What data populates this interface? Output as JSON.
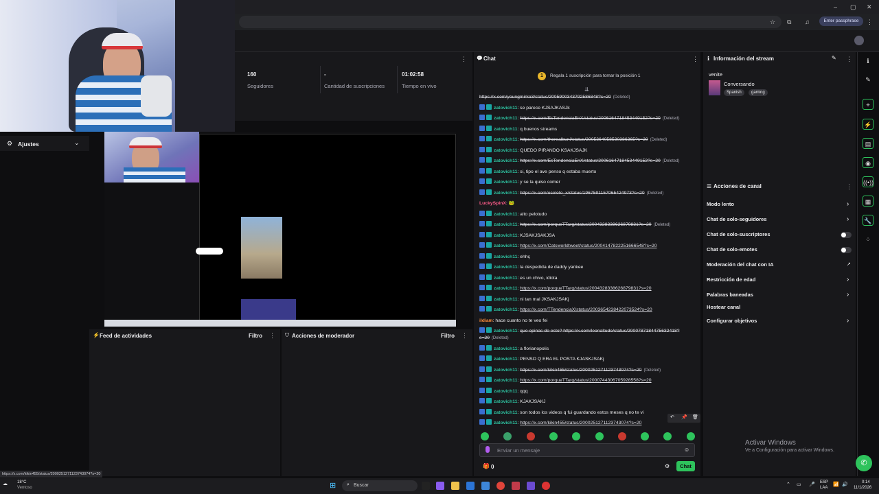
{
  "browser": {
    "passphrase_label": "Enter passphrase"
  },
  "stats": [
    {
      "value": "160",
      "label": "Seguidores"
    },
    {
      "value": "-",
      "label": "Cantidad de suscripciones"
    },
    {
      "value": "01:02:58",
      "label": "Tiempo en vivo"
    }
  ],
  "ajustes": {
    "label": "Ajustes"
  },
  "feed": {
    "title": "Feed de actividades",
    "filter": "Filtro"
  },
  "mod": {
    "title": "Acciones de moderador",
    "filter": "Filtro"
  },
  "chat": {
    "title": "Chat",
    "gift_banner": "Regala 1 suscripción para tomar la posición 1",
    "gift_rank": "1",
    "messages": [
      {
        "user": "",
        "text": "https://x.com/youngmirko3/status/2005900343792586848?s=20",
        "deleted": "(Deleted)"
      },
      {
        "user": "zatovich11",
        "text": "se parece KJSAJKASJk",
        "deleted": ""
      },
      {
        "user": "zatovich11",
        "text": "https://x.com/EsTendenciaEnX/status/2006164718453449152?s=20",
        "deleted": "(Deleted)"
      },
      {
        "user": "zatovich11",
        "text": "q buenos streams",
        "deleted": ""
      },
      {
        "user": "zatovich11",
        "text": "https://x.com/therealbuni/status/2005364058530386365?s=20",
        "deleted": "(Deleted)"
      },
      {
        "user": "zatovich11",
        "text": "QUEDO PIRANDO KSAKJSAJK",
        "deleted": ""
      },
      {
        "user": "zatovich11",
        "text": "https://x.com/EsTendenciaEnX/status/2006164718453449152?s=20",
        "deleted": "(Deleted)"
      },
      {
        "user": "zatovich11",
        "text": "si, tipo el ave penso q estaba muerto",
        "deleted": ""
      },
      {
        "user": "zatovich11",
        "text": "y se la quiso comer",
        "deleted": ""
      },
      {
        "user": "zatovich11",
        "text": "https://x.com/ocelote_x/status/1967591157065424973?s=20",
        "deleted": "(Deleted)"
      },
      {
        "user": "LuckySpinX",
        "text": "🐸",
        "deleted": ""
      },
      {
        "user": "zatovich11",
        "text": "alto pelotudo",
        "deleted": ""
      },
      {
        "user": "zatovich11",
        "text": "https://x.com/porqueTTarg/status/2004328338626879831?s=20",
        "deleted": "(Deleted)"
      },
      {
        "user": "zatovich11",
        "text": "KJSAKJSAKJSA",
        "deleted": ""
      },
      {
        "user": "zatovich11",
        "text": "https://x.com/Catsworldtweet/status/2004147822251666548?s=20",
        "deleted": ""
      },
      {
        "user": "zatovich11",
        "text": "ehhç",
        "deleted": ""
      },
      {
        "user": "zatovich11",
        "text": "la despedida de daddy yankee",
        "deleted": ""
      },
      {
        "user": "zatovich11",
        "text": "es un chivo, idiota",
        "deleted": ""
      },
      {
        "user": "zatovich11",
        "text": "https://x.com/porqueTTarg/status/2004328338626879831?s=20",
        "deleted": ""
      },
      {
        "user": "zatovich11",
        "text": "ni tan mal JKSAKJSAKj",
        "deleted": ""
      },
      {
        "user": "zatovich11",
        "text": "https://x.com/TTendenciaX/status/2003654238422073524?s=20",
        "deleted": ""
      },
      {
        "user": "ildiam",
        "text": "hace cuanto no te veo fei",
        "deleted": ""
      },
      {
        "user": "zatovich11",
        "text": "que opinas de esto? https://x.com/leonaltudo/status/2000787184475632418?s=20",
        "deleted": "(Deleted)"
      },
      {
        "user": "zatovich11",
        "text": "a florianopolis",
        "deleted": ""
      },
      {
        "user": "zatovich11",
        "text": "PENSO Q ERA EL POSTA KJASKJSAKj",
        "deleted": ""
      },
      {
        "user": "zatovich11",
        "text": "https://x.com/kikin455/status/2000251271123743074?s=20",
        "deleted": "(Deleted)"
      },
      {
        "user": "zatovich11",
        "text": "https://x.com/porqueTTarg/status/2000744306705928558?s=20",
        "deleted": ""
      },
      {
        "user": "zatovich11",
        "text": "qqq",
        "deleted": ""
      },
      {
        "user": "zatovich11",
        "text": "KJAKJSAKJ",
        "deleted": ""
      },
      {
        "user": "zatovich11",
        "text": "son todos los videos q fui guardando estos meses q no te vi",
        "deleted": ""
      },
      {
        "user": "zatovich11",
        "text": "https://x.com/kikin455/status/2000251271123743074?s=20",
        "deleted": ""
      }
    ],
    "input_placeholder": "Enviar un mensaje",
    "points": "0",
    "send_label": "Chat"
  },
  "info": {
    "title": "Información del stream",
    "channel": "venite",
    "category": "Conversando",
    "tags": [
      "Spanish",
      "gaming"
    ]
  },
  "acciones": {
    "title": "Acciones de canal",
    "items": [
      {
        "label": "Modo lento",
        "control": "chevron"
      },
      {
        "label": "Chat de solo-seguidores",
        "control": "chevron"
      },
      {
        "label": "Chat de solo-suscriptores",
        "control": "toggle"
      },
      {
        "label": "Chat de solo-emotes",
        "control": "toggle"
      },
      {
        "label": "Moderación del chat con IA",
        "control": "ext"
      },
      {
        "label": "Restricción de edad",
        "control": "chevron"
      },
      {
        "label": "Palabras baneadas",
        "control": "chevron"
      },
      {
        "label": "Hostear canal",
        "control": "none"
      },
      {
        "label": "Configurar objetivos",
        "control": "chevron"
      }
    ]
  },
  "windows": {
    "activate_title": "Activar Windows",
    "activate_sub": "Ve a Configuración para activar Windows."
  },
  "statusbar": {
    "url": "https://x.com/kikin455/status/2000251271123743074?s=20"
  },
  "taskbar": {
    "weather_temp": "18°C",
    "weather_desc": "Ventoso",
    "search": "Buscar",
    "lang": "ESP",
    "lang2": "LAA",
    "time": "0:14",
    "date": "11/1/2026"
  }
}
